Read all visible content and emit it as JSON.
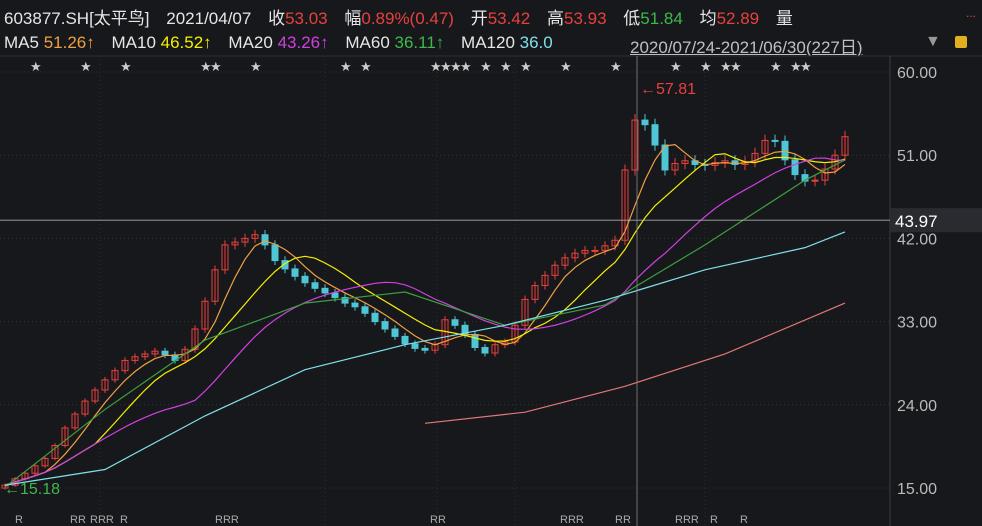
{
  "header": {
    "symbol": "603877.SH[太平鸟]",
    "date": "2021/04/07",
    "close_label": "收",
    "close": "53.03",
    "chg_label": "幅",
    "chg": "0.89%(0.47)",
    "open_label": "开",
    "open": "53.42",
    "high_label": "高",
    "high": "53.93",
    "low_label": "低",
    "low": "51.84",
    "avg_label": "均",
    "avg": "52.89",
    "vol_label": "量",
    "more": "..."
  },
  "ma_bar": {
    "ma5_label": "MA5",
    "ma5": "51.26↑",
    "ma10_label": "MA10",
    "ma10": "46.52↑",
    "ma20_label": "MA20",
    "ma20": "43.26↑",
    "ma60_label": "MA60",
    "ma60": "36.11↑",
    "ma120_label": "MA120",
    "ma120": "36.0",
    "interval": "2020/07/24-2021/06/30(227日)",
    "dropdown_icon": "triangle-down",
    "lock_icon": "lock"
  },
  "chart_data": {
    "type": "candlestick",
    "ylim": [
      15,
      60
    ],
    "yticks": [
      "60.00",
      "51.00",
      "42.00",
      "33.00",
      "24.00",
      "15.00"
    ],
    "crosshair": {
      "price": "43.97",
      "index": 63
    },
    "max_label": "←57.81",
    "min_label": "←15.18",
    "colors": {
      "up": "#e8413c",
      "down": "#4fc6d6",
      "ma5": "#f0a040",
      "ma10": "#f4f000",
      "ma20": "#d040e0",
      "ma60": "#3da03d",
      "ma120": "#7fe0e8",
      "ma250": "#e07878"
    },
    "closes": [
      15.3,
      16.0,
      16.6,
      17.4,
      18.2,
      19.6,
      21.5,
      23.0,
      24.4,
      25.6,
      26.7,
      27.7,
      28.8,
      29.2,
      29.5,
      29.8,
      29.4,
      28.8,
      30.0,
      32.2,
      35.2,
      38.6,
      41.3,
      41.6,
      42.0,
      42.4,
      41.3,
      39.6,
      38.7,
      37.9,
      37.2,
      36.6,
      36.1,
      35.6,
      35.0,
      34.6,
      33.9,
      33.0,
      32.2,
      31.4,
      30.6,
      30.1,
      29.9,
      30.5,
      33.2,
      32.6,
      31.6,
      30.2,
      29.6,
      30.5,
      30.8,
      32.6,
      35.4,
      36.9,
      38.0,
      39.1,
      39.9,
      40.4,
      40.7,
      40.7,
      41.2,
      41.8,
      49.4,
      54.8,
      54.3,
      52.1,
      49.4,
      50.1,
      50.4,
      50.0,
      49.9,
      50.2,
      50.4,
      50.0,
      50.3,
      51.2,
      52.6,
      52.5,
      50.5,
      48.9,
      48.2,
      48.3,
      49.5,
      51.0,
      53.0
    ],
    "ma60": [
      [
        0,
        15.1
      ],
      [
        10,
        23.5
      ],
      [
        20,
        31.0
      ],
      [
        30,
        35.0
      ],
      [
        40,
        36.2
      ],
      [
        50,
        32.6
      ],
      [
        60,
        34.8
      ],
      [
        70,
        41.3
      ],
      [
        80,
        48.3
      ],
      [
        84,
        50.5
      ]
    ],
    "ma120": [
      [
        0,
        15.3
      ],
      [
        10,
        17.0
      ],
      [
        20,
        22.8
      ],
      [
        30,
        27.8
      ],
      [
        40,
        30.5
      ],
      [
        50,
        32.6
      ],
      [
        60,
        35.3
      ],
      [
        70,
        38.6
      ],
      [
        80,
        41.0
      ],
      [
        84,
        42.7
      ]
    ],
    "ma250": [
      [
        42,
        22.0
      ],
      [
        52,
        23.2
      ],
      [
        62,
        26.0
      ],
      [
        72,
        29.5
      ],
      [
        84,
        35.0
      ]
    ],
    "star_markers": [
      3,
      8,
      12,
      20,
      21,
      25,
      34,
      36,
      43,
      44,
      45,
      46,
      48,
      50,
      52,
      56,
      61,
      67,
      70,
      72,
      73,
      77,
      79,
      80
    ],
    "r_markers": [
      {
        "i": 1.5,
        "t": "R"
      },
      {
        "i": 7,
        "t": "RR"
      },
      {
        "i": 9,
        "t": "RRR"
      },
      {
        "i": 12,
        "t": "R"
      },
      {
        "i": 21.5,
        "t": "RRR"
      },
      {
        "i": 43,
        "t": "RR"
      },
      {
        "i": 56,
        "t": "RRR"
      },
      {
        "i": 61.5,
        "t": "RR"
      },
      {
        "i": 67.5,
        "t": "RRR"
      },
      {
        "i": 71,
        "t": "R"
      },
      {
        "i": 74,
        "t": "R"
      }
    ]
  }
}
